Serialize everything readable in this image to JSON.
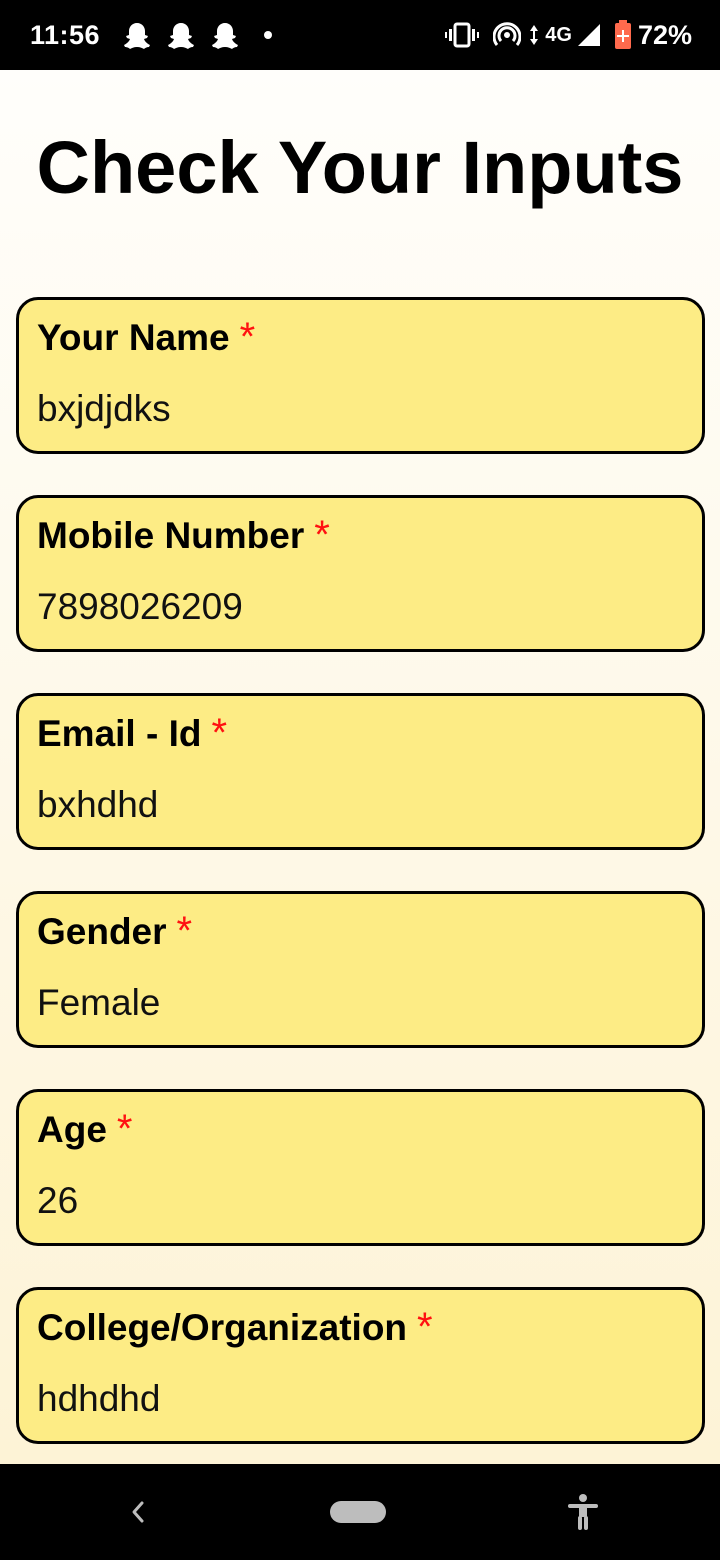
{
  "status_bar": {
    "time": "11:56",
    "network": "4G",
    "battery_percent": "72%",
    "icons": [
      "snapchat-icon",
      "snapchat-icon",
      "snapchat-icon",
      "notification-dot",
      "vibrate-icon",
      "hotspot-icon",
      "data-arrows-icon",
      "signal-icon",
      "battery-saver-icon"
    ]
  },
  "page": {
    "title": "Check Your Inputs"
  },
  "fields": [
    {
      "label": "Your Name",
      "required_mark": "*",
      "value": "bxjdjdks"
    },
    {
      "label": "Mobile Number",
      "required_mark": "*",
      "value": "7898026209"
    },
    {
      "label": "Email - Id",
      "required_mark": "*",
      "value": "bxhdhd"
    },
    {
      "label": "Gender",
      "required_mark": "*",
      "value": "Female"
    },
    {
      "label": "Age",
      "required_mark": "*",
      "value": "26"
    },
    {
      "label": "College/Organization",
      "required_mark": "*",
      "value": "hdhdhd"
    }
  ],
  "nav_bar": {
    "icons": [
      "back-icon",
      "home-pill",
      "accessibility-icon"
    ]
  },
  "colors": {
    "card_background": "#fdec85",
    "required_mark": "#ff1111",
    "page_background_top": "#fffefb",
    "page_background_bottom": "#fdf3d6"
  }
}
